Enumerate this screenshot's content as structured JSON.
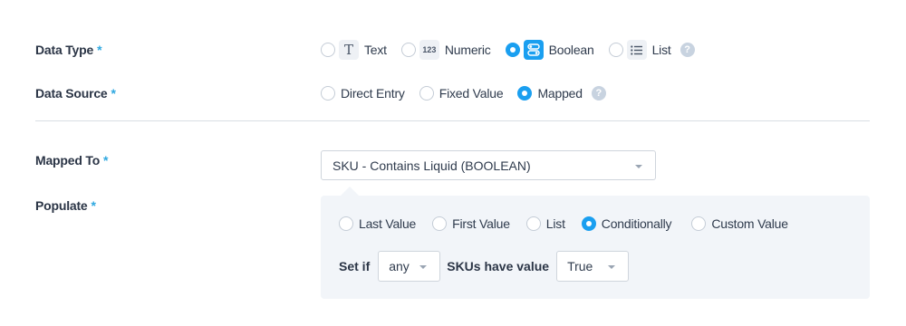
{
  "data_type": {
    "label": "Data Type",
    "required": "*",
    "options": [
      {
        "label": "Text",
        "icon": "text-icon",
        "glyph": "T",
        "checked": false
      },
      {
        "label": "Numeric",
        "icon": "numeric-icon",
        "glyph": "123",
        "checked": false
      },
      {
        "label": "Boolean",
        "icon": "toggle-icon",
        "glyph": "",
        "checked": true
      },
      {
        "label": "List",
        "icon": "list-icon",
        "glyph": "",
        "checked": false
      }
    ],
    "help": "?"
  },
  "data_source": {
    "label": "Data Source",
    "required": "*",
    "options": [
      {
        "label": "Direct Entry",
        "checked": false
      },
      {
        "label": "Fixed Value",
        "checked": false
      },
      {
        "label": "Mapped",
        "checked": true
      }
    ],
    "help": "?"
  },
  "mapped_to": {
    "label": "Mapped To",
    "required": "*",
    "value": "SKU - Contains Liquid (BOOLEAN)"
  },
  "populate": {
    "label": "Populate",
    "required": "*",
    "options": [
      {
        "label": "Last Value",
        "checked": false
      },
      {
        "label": "First Value",
        "checked": false
      },
      {
        "label": "List",
        "checked": false
      },
      {
        "label": "Conditionally",
        "checked": true
      },
      {
        "label": "Custom Value",
        "checked": false
      }
    ],
    "condition": {
      "prefix": "Set if",
      "quantifier": "any",
      "middle": "SKUs have value",
      "value": "True"
    }
  },
  "colors": {
    "accent": "#1a9ff0",
    "required": "#2fa8e0",
    "panel_bg": "#f2f5f9"
  }
}
